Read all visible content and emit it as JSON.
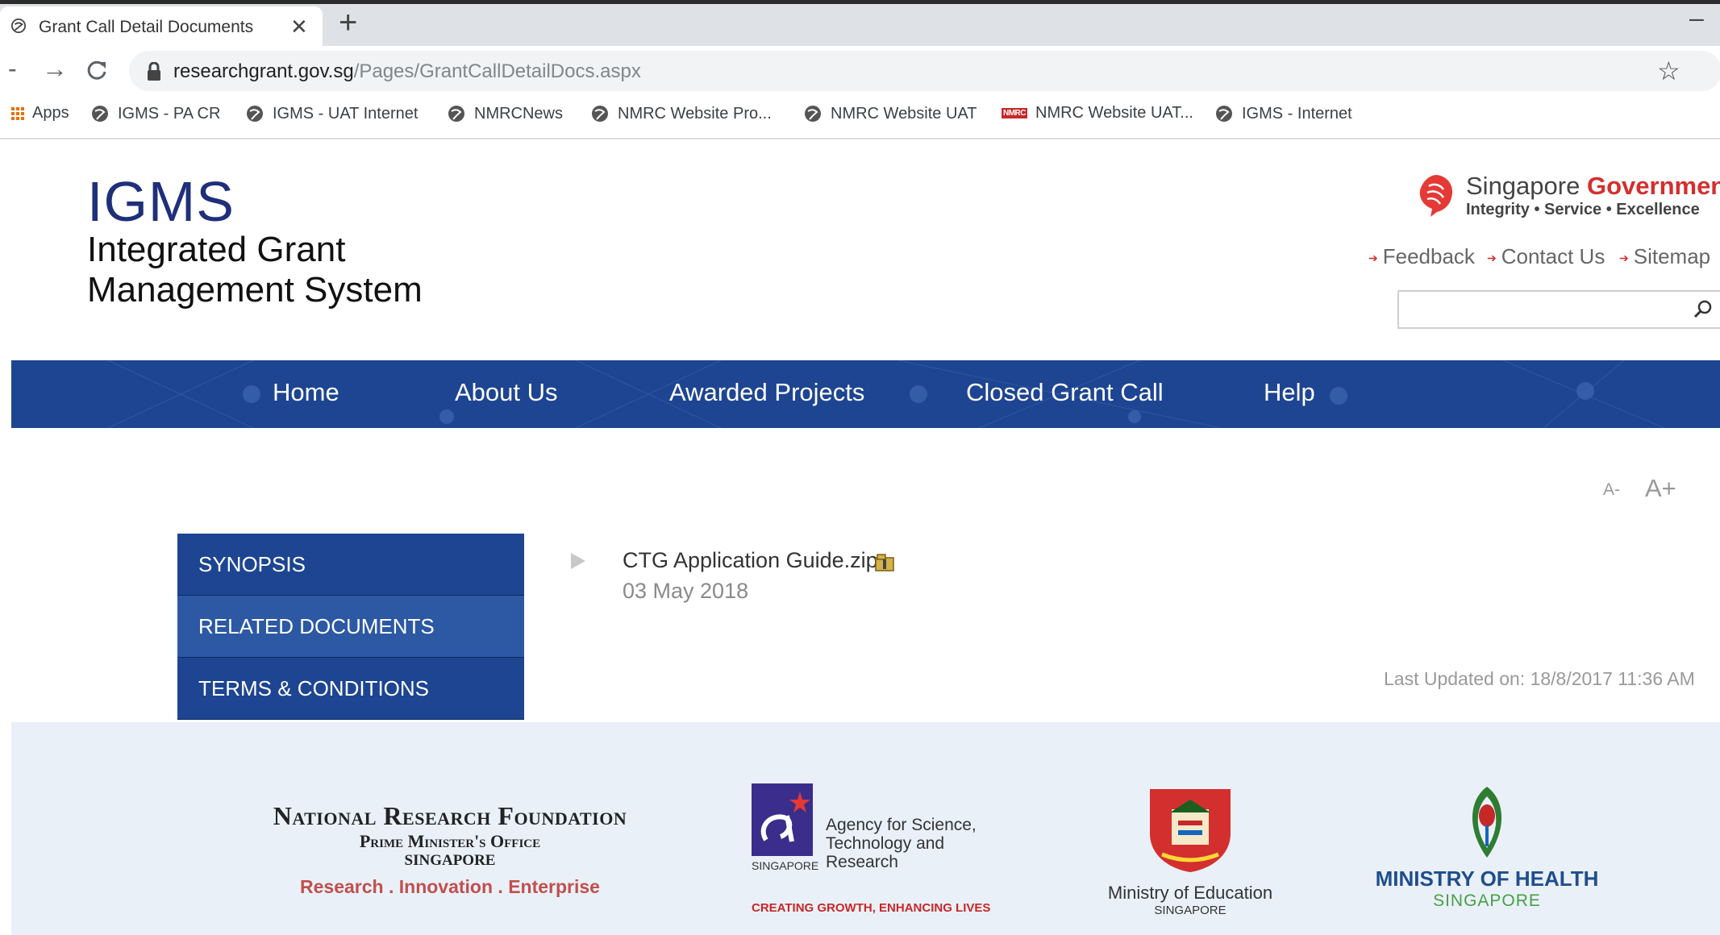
{
  "browser": {
    "tab_title": "Grant Call Detail Documents",
    "close_glyph": "✕",
    "newtab_glyph": "+",
    "minimize_glyph": "–",
    "back_glyph": "-",
    "forward_glyph": "→",
    "reload_glyph": "C",
    "url_host": "researchgrant.gov.sg",
    "url_path": "/Pages/GrantCallDetailDocs.aspx",
    "star_glyph": "☆",
    "bookmarks": [
      {
        "label": "Apps",
        "icon": "apps-grid-icon"
      },
      {
        "label": "IGMS - PA CR",
        "icon": "globe-icon"
      },
      {
        "label": "IGMS - UAT Internet",
        "icon": "globe-icon"
      },
      {
        "label": "NMRCNews",
        "icon": "globe-icon"
      },
      {
        "label": "NMRC Website Pro...",
        "icon": "globe-icon"
      },
      {
        "label": "NMRC Website UAT",
        "icon": "globe-icon"
      },
      {
        "label": "NMRC Website UAT...",
        "icon": "nmrc-logo-icon"
      },
      {
        "label": "IGMS - Internet",
        "icon": "globe-icon"
      }
    ],
    "nmrc_badge": "NMRC"
  },
  "header": {
    "logo_acronym": "IGMS",
    "logo_line1": "Integrated Grant",
    "logo_line2": "Management System",
    "sg_word": "Singapore",
    "gov_word": "Government",
    "sg_tagline": "Integrity • Service • Excellence",
    "links": [
      "Feedback",
      "Contact Us",
      "Sitemap"
    ],
    "link_arrow": "➔"
  },
  "nav": {
    "items": [
      "Home",
      "About Us",
      "Awarded Projects",
      "Closed Grant Call",
      "Help"
    ]
  },
  "content": {
    "font_smaller": "A-",
    "font_larger": "A+",
    "side_menu": [
      "SYNOPSIS",
      "RELATED DOCUMENTS",
      "TERMS & CONDITIONS"
    ],
    "active_menu": "RELATED DOCUMENTS",
    "document_name": "CTG Application Guide.zip",
    "document_date": "03 May 2018",
    "last_updated": "Last Updated on: 18/8/2017 11:36 AM"
  },
  "footer": {
    "nrf_line1": "National Research Foundation",
    "nrf_line2": "Prime Minister's Office",
    "nrf_line3": "SINGAPORE",
    "nrf_line4": "Research . Innovation . Enterprise",
    "astar_text": "Agency for Science, Technology and Research",
    "astar_singapore": "SINGAPORE",
    "astar_tagline": "CREATING GROWTH, ENHANCING LIVES",
    "moe_line1": "Ministry of Education",
    "moe_line2": "SINGAPORE",
    "moh_line1": "MINISTRY OF HEALTH",
    "moh_line2": "SINGAPORE"
  },
  "colors": {
    "nav_blue": "#1d4591",
    "menu_active": "#2c58a4",
    "igms_blue": "#1f2f7a",
    "gov_red": "#d32f2f",
    "footer_bg": "#eaf0f8"
  }
}
